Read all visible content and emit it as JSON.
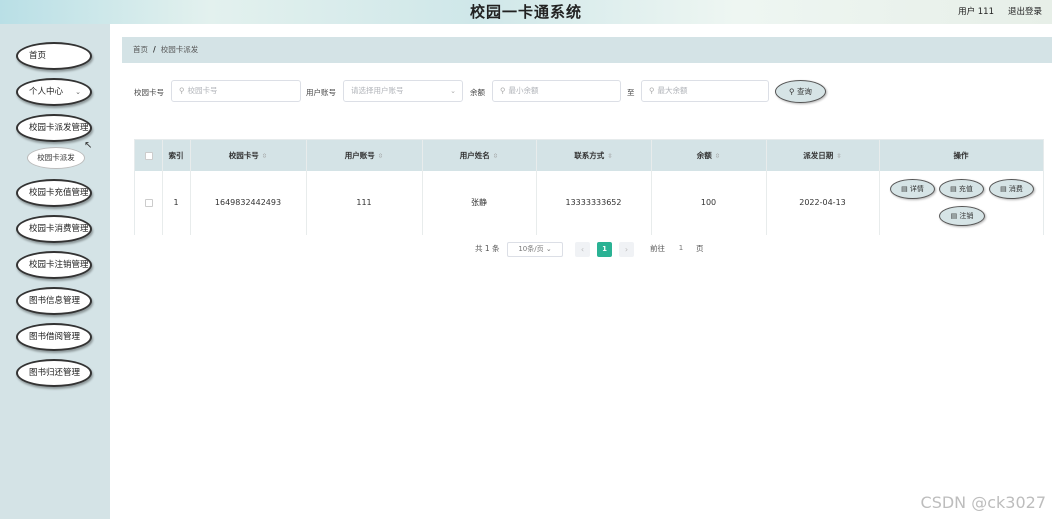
{
  "header": {
    "title": "校园一卡通系统",
    "user": "用户 111",
    "logout": "退出登录"
  },
  "sidebar": {
    "items": [
      {
        "label": "首页"
      },
      {
        "label": "个人中心"
      },
      {
        "label": "校园卡派发管理"
      },
      {
        "label": "校园卡充值管理"
      },
      {
        "label": "校园卡消费管理"
      },
      {
        "label": "校园卡注销管理"
      },
      {
        "label": "图书信息管理"
      },
      {
        "label": "图书借阅管理"
      },
      {
        "label": "图书归还管理"
      }
    ],
    "sub_item": "校园卡派发"
  },
  "breadcrumb": {
    "home": "首页",
    "separator": "/",
    "current": "校园卡派发"
  },
  "search": {
    "card_label": "校园卡号",
    "card_placeholder": "校园卡号",
    "account_label": "用户账号",
    "account_placeholder": "请选择用户账号",
    "balance_label": "余额",
    "min_placeholder": "最小余额",
    "to_label": "至",
    "max_placeholder": "最大余额",
    "query_button": "查询"
  },
  "table": {
    "columns": [
      "索引",
      "校园卡号",
      "用户账号",
      "用户姓名",
      "联系方式",
      "余额",
      "派发日期",
      "操作"
    ],
    "rows": [
      {
        "index": "1",
        "card_no": "1649832442493",
        "account": "111",
        "name": "张静",
        "phone": "13333333652",
        "balance": "100",
        "date": "2022-04-13"
      }
    ],
    "actions": [
      "详情",
      "充值",
      "消费",
      "注销"
    ]
  },
  "pagination": {
    "total": "共 1 条",
    "page_size": "10条/页",
    "current_page": "1",
    "goto_label": "前往",
    "goto_value": "1",
    "page_unit": "页"
  },
  "watermark": "CSDN @ck3027"
}
